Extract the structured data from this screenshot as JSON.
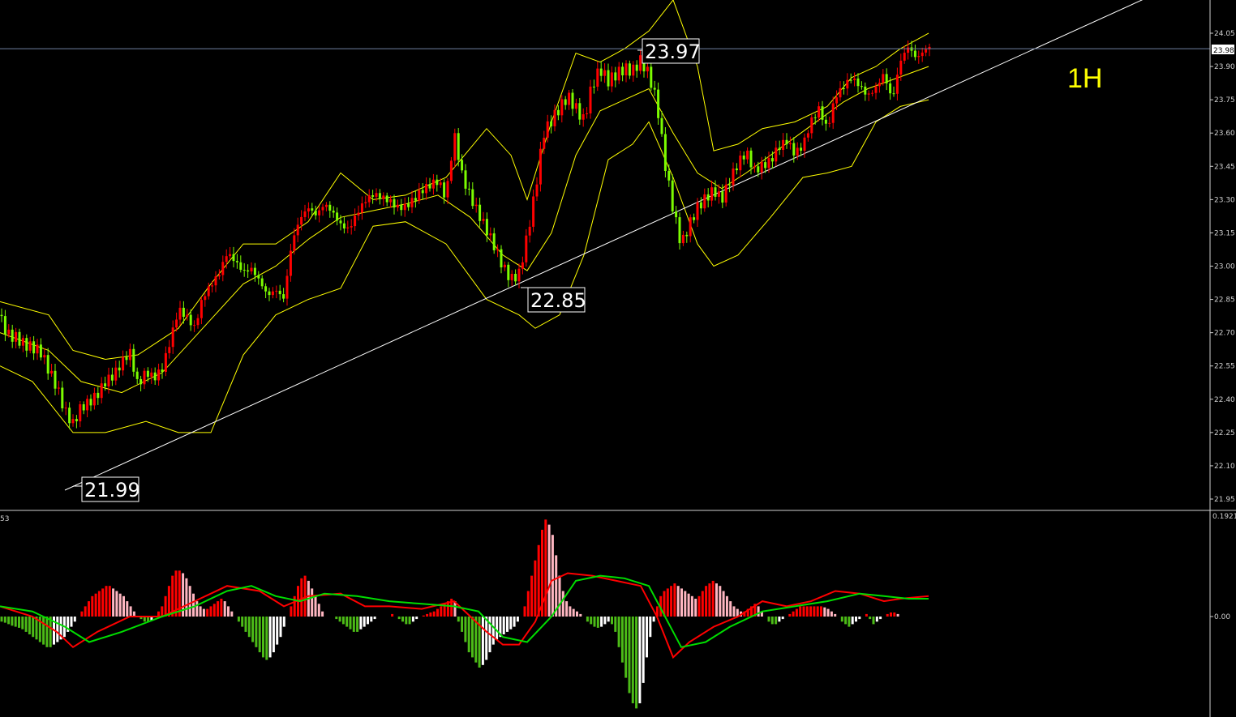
{
  "timeframe_label": "1H",
  "colors": {
    "background": "#000000",
    "bull_candle": "#ff0000",
    "bear_candle": "#7cfc00",
    "bollinger": "#ffff00",
    "trendline": "#ffffff",
    "current_price_line": "#6f7fa0",
    "macd_line": "#ff0000",
    "signal_line": "#00dd00",
    "hist_up_strong": "#ff0000",
    "hist_up_weak": "#ffb6c1",
    "hist_down_strong": "#4cbb17",
    "hist_down_weak": "#ffffff",
    "axis_text": "#d0d0d0"
  },
  "price_axis": {
    "ticks": [
      "24.05",
      "23.90",
      "23.75",
      "23.60",
      "23.45",
      "23.30",
      "23.15",
      "23.00",
      "22.85",
      "22.70",
      "22.55",
      "22.40",
      "22.25",
      "22.10",
      "21.95"
    ],
    "current_price": "23.98"
  },
  "annotations": [
    {
      "label": "23.97"
    },
    {
      "label": "22.85"
    },
    {
      "label": "21.99"
    }
  ],
  "indicator_panel": {
    "left_label": "53",
    "top_value": "0.1921",
    "zero_label": "0.00"
  },
  "chart_data": {
    "type": "line",
    "title": "",
    "xlabel": "",
    "ylabel": "",
    "ylim": [
      21.92,
      24.18
    ],
    "grid": false,
    "price_series": {
      "name": "",
      "x": [
        0,
        10,
        20,
        30,
        40,
        50,
        60,
        70,
        80,
        90,
        100,
        110,
        120,
        130,
        140,
        150,
        160,
        170,
        180,
        190,
        200,
        210,
        220,
        230,
        240,
        250,
        260,
        270,
        280,
        290,
        300,
        310,
        320,
        330,
        340,
        350,
        360,
        370,
        380,
        390,
        400,
        410,
        420,
        430,
        440,
        450,
        460,
        470,
        480,
        490,
        500,
        510,
        520,
        530,
        540,
        550,
        560,
        570,
        580,
        590,
        600,
        610,
        620,
        630,
        640,
        650,
        660,
        670,
        680,
        690,
        700,
        710,
        720,
        730,
        740,
        750,
        760,
        770,
        780,
        790,
        800,
        810,
        820,
        830,
        840,
        850,
        860,
        870,
        880,
        890,
        900,
        910,
        920,
        930,
        940,
        950,
        960,
        970,
        980,
        990,
        1000,
        1010,
        1020,
        1030,
        1040,
        1050,
        1060,
        1070,
        1080,
        1090,
        1100,
        1110,
        1120,
        1130,
        1140,
        1147
      ],
      "y": [
        22.78,
        22.7,
        22.68,
        22.64,
        22.62,
        22.6,
        22.52,
        22.45,
        22.35,
        22.3,
        22.38,
        22.4,
        22.43,
        22.48,
        22.5,
        22.55,
        22.6,
        22.45,
        22.52,
        22.5,
        22.55,
        22.68,
        22.82,
        22.78,
        22.72,
        22.85,
        22.9,
        22.95,
        23.05,
        23.02,
        22.98,
        23.0,
        22.95,
        22.88,
        22.9,
        22.85,
        23.1,
        23.2,
        23.25,
        23.22,
        23.28,
        23.25,
        23.2,
        23.18,
        23.25,
        23.3,
        23.32,
        23.3,
        23.28,
        23.25,
        23.26,
        23.3,
        23.35,
        23.38,
        23.4,
        23.32,
        23.6,
        23.4,
        23.3,
        23.22,
        23.15,
        23.08,
        23.0,
        22.95,
        22.98,
        23.15,
        23.35,
        23.6,
        23.65,
        23.7,
        23.75,
        23.7,
        23.65,
        23.82,
        23.9,
        23.85,
        23.88,
        23.9,
        23.88,
        23.92,
        23.85,
        23.72,
        23.45,
        23.25,
        23.1,
        23.2,
        23.28,
        23.32,
        23.35,
        23.3,
        23.38,
        23.45,
        23.5,
        23.42,
        23.45,
        23.48,
        23.55,
        23.58,
        23.52,
        23.55,
        23.65,
        23.7,
        23.6,
        23.75,
        23.8,
        23.85,
        23.82,
        23.78,
        23.82,
        23.88,
        23.75,
        23.92,
        23.98,
        23.92,
        23.96,
        23.98
      ]
    },
    "bollinger_upper": {
      "x": [
        0,
        60,
        90,
        130,
        170,
        220,
        260,
        300,
        340,
        380,
        420,
        460,
        500,
        550,
        600,
        630,
        650,
        680,
        710,
        740,
        770,
        800,
        830,
        860,
        880,
        910,
        940,
        980,
        1020,
        1050,
        1080,
        1110,
        1145
      ],
      "y": [
        22.84,
        22.78,
        22.62,
        22.58,
        22.6,
        22.72,
        22.92,
        23.1,
        23.1,
        23.2,
        23.42,
        23.3,
        23.32,
        23.4,
        23.62,
        23.5,
        23.3,
        23.65,
        23.96,
        23.92,
        23.98,
        24.06,
        24.2,
        23.9,
        23.52,
        23.55,
        23.62,
        23.65,
        23.72,
        23.85,
        23.9,
        23.98,
        24.05
      ]
    },
    "bollinger_middle": {
      "x": [
        0,
        60,
        100,
        150,
        200,
        250,
        300,
        340,
        380,
        420,
        460,
        500,
        540,
        580,
        620,
        650,
        680,
        710,
        740,
        770,
        800,
        830,
        860,
        890,
        920,
        950,
        980,
        1010,
        1040,
        1070,
        1100,
        1145
      ],
      "y": [
        22.7,
        22.62,
        22.48,
        22.43,
        22.52,
        22.72,
        22.92,
        23.0,
        23.12,
        23.22,
        23.25,
        23.28,
        23.32,
        23.22,
        23.05,
        22.98,
        23.15,
        23.5,
        23.7,
        23.75,
        23.8,
        23.6,
        23.42,
        23.35,
        23.42,
        23.5,
        23.58,
        23.66,
        23.74,
        23.8,
        23.84,
        23.9
      ]
    },
    "bollinger_lower": {
      "x": [
        0,
        40,
        90,
        130,
        180,
        220,
        260,
        300,
        340,
        380,
        420,
        460,
        500,
        550,
        600,
        640,
        660,
        690,
        720,
        750,
        780,
        800,
        830,
        860,
        880,
        910,
        950,
        990,
        1020,
        1050,
        1080,
        1110,
        1145
      ],
      "y": [
        22.55,
        22.48,
        22.25,
        22.25,
        22.3,
        22.25,
        22.25,
        22.6,
        22.78,
        22.85,
        22.9,
        23.18,
        23.2,
        23.1,
        22.85,
        22.78,
        22.72,
        22.78,
        23.05,
        23.48,
        23.55,
        23.65,
        23.4,
        23.1,
        23.0,
        23.05,
        23.22,
        23.4,
        23.42,
        23.45,
        23.65,
        23.72,
        23.75
      ]
    },
    "trendline": {
      "x": [
        80,
        1420
      ],
      "y": [
        21.99,
        24.22
      ]
    },
    "macd_histogram": {
      "x_start": 2,
      "x_step": 4.3,
      "values": [
        -0.01,
        -0.012,
        -0.015,
        -0.018,
        -0.02,
        -0.022,
        -0.025,
        -0.03,
        -0.035,
        -0.04,
        -0.045,
        -0.05,
        -0.055,
        -0.06,
        -0.06,
        -0.055,
        -0.05,
        -0.045,
        -0.04,
        -0.03,
        -0.02,
        -0.01,
        0.0,
        0.01,
        0.02,
        0.03,
        0.04,
        0.045,
        0.05,
        0.055,
        0.06,
        0.06,
        0.055,
        0.05,
        0.045,
        0.04,
        0.03,
        0.02,
        0.01,
        0.0,
        -0.005,
        -0.01,
        -0.01,
        -0.008,
        0.0,
        0.01,
        0.02,
        0.04,
        0.06,
        0.08,
        0.09,
        0.09,
        0.085,
        0.075,
        0.06,
        0.045,
        0.03,
        0.02,
        0.015,
        0.015,
        0.02,
        0.025,
        0.03,
        0.035,
        0.03,
        0.02,
        0.01,
        0.0,
        -0.01,
        -0.02,
        -0.03,
        -0.04,
        -0.05,
        -0.06,
        -0.07,
        -0.08,
        -0.085,
        -0.08,
        -0.07,
        -0.055,
        -0.04,
        -0.02,
        0.0,
        0.02,
        0.04,
        0.06,
        0.075,
        0.08,
        0.07,
        0.055,
        0.04,
        0.025,
        0.01,
        0.0,
        0.0,
        0.0,
        -0.005,
        -0.01,
        -0.015,
        -0.02,
        -0.025,
        -0.03,
        -0.03,
        -0.025,
        -0.02,
        -0.015,
        -0.01,
        -0.005,
        0.0,
        0.0,
        0.0,
        0.0,
        0.005,
        0.0,
        -0.005,
        -0.01,
        -0.015,
        -0.015,
        -0.01,
        -0.005,
        0.0,
        0.002,
        0.005,
        0.008,
        0.01,
        0.015,
        0.02,
        0.025,
        0.03,
        0.035,
        0.03,
        -0.01,
        -0.03,
        -0.05,
        -0.07,
        -0.08,
        -0.09,
        -0.1,
        -0.095,
        -0.085,
        -0.07,
        -0.055,
        -0.045,
        -0.04,
        -0.035,
        -0.03,
        -0.025,
        -0.02,
        -0.01,
        0.0,
        0.02,
        0.05,
        0.08,
        0.11,
        0.14,
        0.17,
        0.19,
        0.18,
        0.16,
        0.12,
        0.08,
        0.05,
        0.03,
        0.02,
        0.015,
        0.01,
        0.005,
        0.0,
        -0.01,
        -0.015,
        -0.02,
        -0.022,
        -0.02,
        -0.015,
        -0.01,
        -0.015,
        -0.03,
        -0.06,
        -0.09,
        -0.12,
        -0.15,
        -0.17,
        -0.18,
        -0.17,
        -0.13,
        -0.08,
        -0.04,
        -0.01,
        0.02,
        0.04,
        0.05,
        0.055,
        0.06,
        0.065,
        0.06,
        0.055,
        0.05,
        0.045,
        0.04,
        0.035,
        0.04,
        0.05,
        0.06,
        0.065,
        0.07,
        0.065,
        0.06,
        0.05,
        0.04,
        0.03,
        0.02,
        0.015,
        0.01,
        0.01,
        0.015,
        0.02,
        0.025,
        0.02,
        0.01,
        0.0,
        -0.01,
        -0.015,
        -0.015,
        -0.01,
        -0.005,
        0.0,
        0.005,
        0.01,
        0.015,
        0.02,
        0.02,
        0.02,
        0.02,
        0.02,
        0.02,
        0.02,
        0.018,
        0.015,
        0.01,
        0.005,
        0.0,
        -0.01,
        -0.015,
        -0.02,
        -0.015,
        -0.01,
        -0.005,
        0.0,
        0.005,
        -0.005,
        -0.015,
        -0.01,
        -0.005,
        0.0,
        0.005,
        0.008,
        0.008,
        0.005
      ]
    },
    "macd_line": {
      "x": [
        0,
        40,
        70,
        90,
        120,
        160,
        200,
        240,
        280,
        320,
        350,
        380,
        420,
        450,
        480,
        520,
        560,
        580,
        600,
        620,
        640,
        660,
        680,
        700,
        730,
        760,
        790,
        810,
        830,
        850,
        880,
        910,
        940,
        970,
        1000,
        1030,
        1060,
        1090,
        1110,
        1145
      ],
      "y": [
        0.02,
        0.0,
        -0.03,
        -0.06,
        -0.03,
        0.0,
        0.0,
        0.03,
        0.06,
        0.05,
        0.02,
        0.04,
        0.045,
        0.02,
        0.02,
        0.015,
        0.03,
        0.0,
        -0.03,
        -0.055,
        -0.055,
        -0.01,
        0.07,
        0.085,
        0.08,
        0.07,
        0.06,
        0.0,
        -0.08,
        -0.05,
        -0.02,
        0.0,
        0.03,
        0.02,
        0.03,
        0.05,
        0.045,
        0.03,
        0.035,
        0.04
      ]
    },
    "signal_line": {
      "x": [
        0,
        40,
        80,
        110,
        150,
        200,
        240,
        280,
        310,
        340,
        370,
        400,
        440,
        480,
        520,
        560,
        590,
        620,
        650,
        680,
        710,
        740,
        770,
        800,
        820,
        840,
        870,
        900,
        940,
        980,
        1020,
        1060,
        1090,
        1120,
        1145
      ],
      "y": [
        0.02,
        0.01,
        -0.02,
        -0.05,
        -0.03,
        0.0,
        0.02,
        0.05,
        0.06,
        0.04,
        0.03,
        0.045,
        0.04,
        0.03,
        0.025,
        0.02,
        0.01,
        -0.04,
        -0.05,
        0.0,
        0.07,
        0.08,
        0.075,
        0.06,
        0.0,
        -0.06,
        -0.05,
        -0.02,
        0.01,
        0.02,
        0.03,
        0.045,
        0.04,
        0.035,
        0.035
      ]
    }
  }
}
